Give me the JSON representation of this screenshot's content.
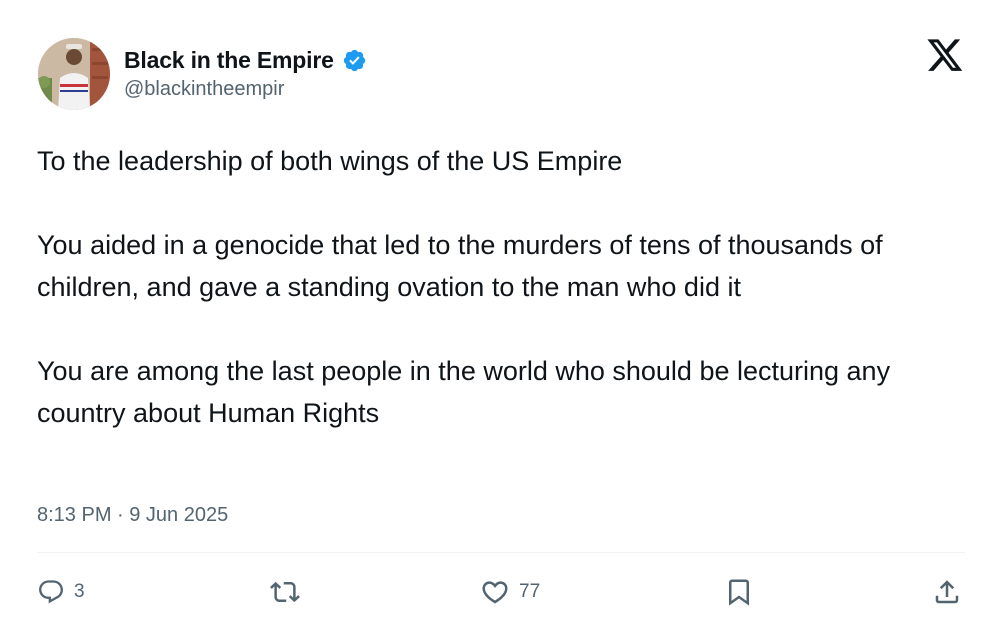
{
  "author": {
    "display_name": "Black in the Empire",
    "handle": "@blackintheempir",
    "verified": true,
    "verified_color": "#1d9bf0"
  },
  "tweet": {
    "paragraphs": [
      "To the leadership of both wings of the US Empire",
      "You aided in a genocide that led to the murders of tens of thousands of children, and gave a standing ovation to the man who did it",
      "You are among the last people in the world who should be lecturing any country about Human Rights"
    ],
    "timestamp": "8:13 PM · 9 Jun 2025"
  },
  "actions": {
    "reply_count": "3",
    "like_count": "77"
  },
  "icons": {
    "platform": "x-logo-icon",
    "verified": "verified-badge-icon",
    "reply": "reply-icon",
    "retweet": "retweet-icon",
    "like": "heart-icon",
    "bookmark": "bookmark-icon",
    "share": "share-icon"
  },
  "colors": {
    "text_primary": "#0f1419",
    "text_secondary": "#536471",
    "divider": "#eff3f4"
  }
}
